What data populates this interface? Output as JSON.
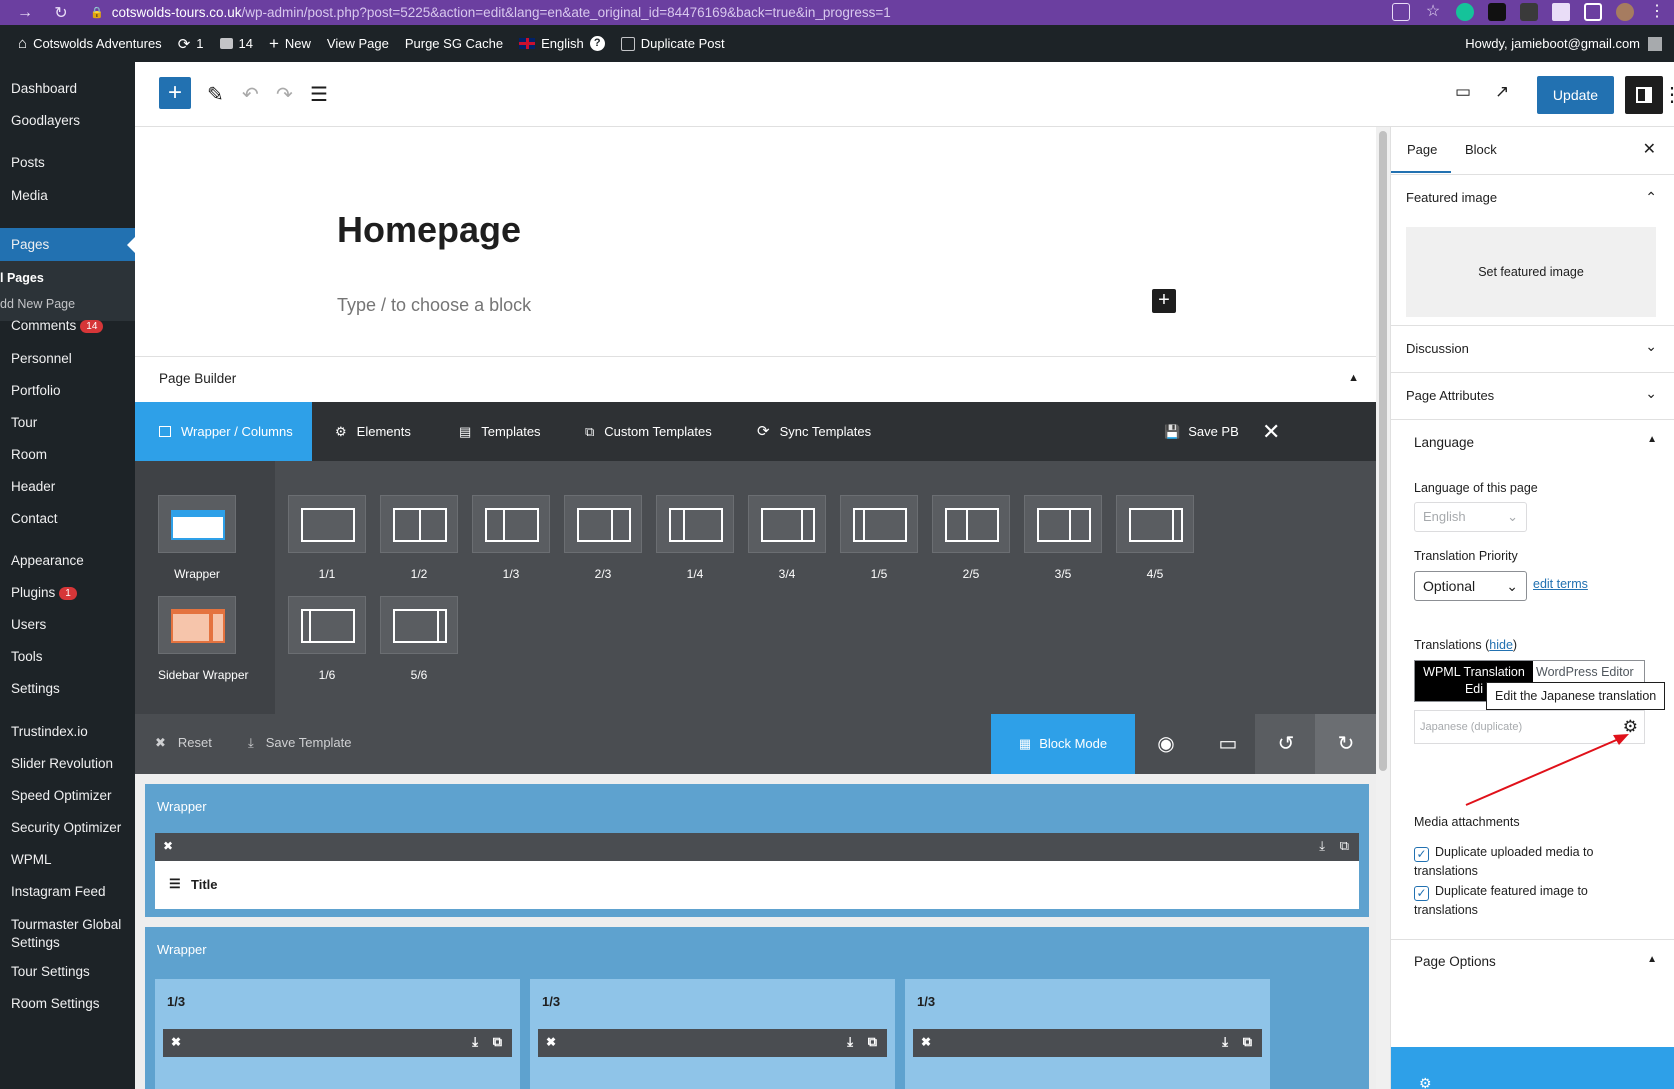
{
  "browser": {
    "url_domain": "cotswolds-tours.co.uk",
    "url_path": "/wp-admin/post.php?post=5225&action=edit&lang=en&ate_original_id=84476169&back=true&in_progress=1"
  },
  "adminbar": {
    "site_name": "Cotswolds Adventures",
    "updates_count": "1",
    "comments_count": "14",
    "new_label": "New",
    "view_page": "View Page",
    "purge_cache": "Purge SG Cache",
    "language": "English",
    "duplicate_post": "Duplicate Post",
    "howdy": "Howdy, jamieboot@gmail.com"
  },
  "sidebar": {
    "dashboard": "Dashboard",
    "goodlayers": "Goodlayers",
    "posts": "Posts",
    "media": "Media",
    "pages": "Pages",
    "all_pages": "l Pages",
    "add_new_page": "dd New Page",
    "comments": "Comments",
    "comments_badge": "14",
    "personnel": "Personnel",
    "portfolio": "Portfolio",
    "tour": "Tour",
    "room": "Room",
    "header": "Header",
    "contact": "Contact",
    "appearance": "Appearance",
    "plugins": "Plugins",
    "plugins_badge": "1",
    "users": "Users",
    "tools": "Tools",
    "settings": "Settings",
    "trustindex": "Trustindex.io",
    "slider_revolution": "Slider Revolution",
    "speed_optimizer": "Speed Optimizer",
    "security_optimizer": "Security Optimizer",
    "wpml": "WPML",
    "instagram_feed": "Instagram Feed",
    "tourmaster_global_1": "Tourmaster Global",
    "tourmaster_global_2": "Settings",
    "tour_settings": "Tour Settings",
    "room_settings": "Room Settings"
  },
  "toolbar": {
    "update_label": "Update"
  },
  "editor": {
    "title": "Homepage",
    "placeholder": "Type / to choose a block"
  },
  "page_builder": {
    "header": "Page Builder",
    "tabs": {
      "wrapper_columns": "Wrapper / Columns",
      "elements": "Elements",
      "templates": "Templates",
      "custom_templates": "Custom Templates",
      "sync_templates": "Sync Templates",
      "save_pb": "Save PB"
    },
    "wrapper_label": "Wrapper",
    "sidebar_wrapper_label": "Sidebar Wrapper",
    "columns": [
      "1/1",
      "1/2",
      "1/3",
      "2/3",
      "1/4",
      "3/4",
      "1/5",
      "2/5",
      "3/5",
      "4/5",
      "1/6",
      "5/6"
    ],
    "reset": "Reset",
    "save_template": "Save Template",
    "block_mode": "Block Mode",
    "canvas": {
      "wrapper1_label": "Wrapper",
      "title_item": "Title",
      "wrapper2_label": "Wrapper",
      "col_a": "1/3",
      "col_b": "1/3",
      "col_c": "1/3"
    }
  },
  "panel": {
    "tab_page": "Page",
    "tab_block": "Block",
    "featured_image": "Featured image",
    "set_featured": "Set featured image",
    "discussion": "Discussion",
    "page_attributes": "Page Attributes",
    "language": "Language",
    "language_of_page": "Language of this page",
    "language_value": "English",
    "translation_priority": "Translation Priority",
    "priority_value": "Optional",
    "edit_terms": "edit terms",
    "translations": "Translations",
    "hide": "hide",
    "wpml_translation_1": "WPML Translation",
    "wpml_translation_2": "Edi",
    "wordpress_editor": "WordPress Editor",
    "tooltip": "Edit the Japanese translation",
    "japanese": "Japanese (duplicate)",
    "media_attachments": "Media attachments",
    "dup_media_1": "Duplicate uploaded media to",
    "dup_media_2": "translations",
    "dup_featured_1": "Duplicate featured image to",
    "dup_featured_2": "translations",
    "page_options": "Page Options"
  }
}
